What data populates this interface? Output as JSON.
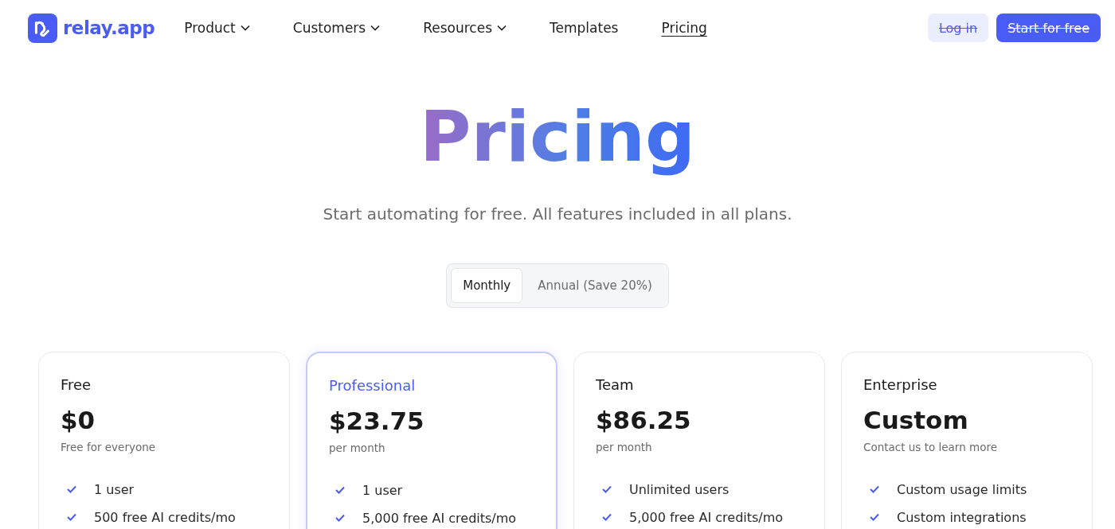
{
  "header": {
    "logo": "relay.app",
    "nav": [
      {
        "label": "Product",
        "dropdown": true,
        "selected": false
      },
      {
        "label": "Customers",
        "dropdown": true,
        "selected": false
      },
      {
        "label": "Resources",
        "dropdown": true,
        "selected": false
      },
      {
        "label": "Templates",
        "dropdown": false,
        "selected": false
      },
      {
        "label": "Pricing",
        "dropdown": false,
        "selected": true
      }
    ],
    "buttons": [
      {
        "label": "Log in",
        "kind": "secondary",
        "strikethrough": true
      },
      {
        "label": "Start for free",
        "kind": "primary",
        "strikethrough": true
      }
    ]
  },
  "hero": {
    "title": "Pricing",
    "subtitle": "Start automating for free. All features included in all plans."
  },
  "billing_toggle": [
    {
      "label": "Monthly",
      "selected": true
    },
    {
      "label": "Annual (Save 20%)",
      "selected": false
    }
  ],
  "plans": [
    {
      "name": "Free",
      "price": "$0",
      "note": "Free for everyone",
      "highlighted": false,
      "features": [
        "1 user",
        "500 free AI credits/mo"
      ]
    },
    {
      "name": "Professional",
      "price": "$23.75",
      "note": "per month",
      "highlighted": true,
      "features": [
        "1 user",
        "5,000 free AI credits/mo"
      ]
    },
    {
      "name": "Team",
      "price": "$86.25",
      "note": "per month",
      "highlighted": false,
      "features": [
        "Unlimited users",
        "5,000 free AI credits/mo"
      ]
    },
    {
      "name": "Enterprise",
      "price": "Custom",
      "note": "Contact us to learn more",
      "highlighted": false,
      "features": [
        "Custom usage limits",
        "Custom integrations"
      ]
    }
  ]
}
